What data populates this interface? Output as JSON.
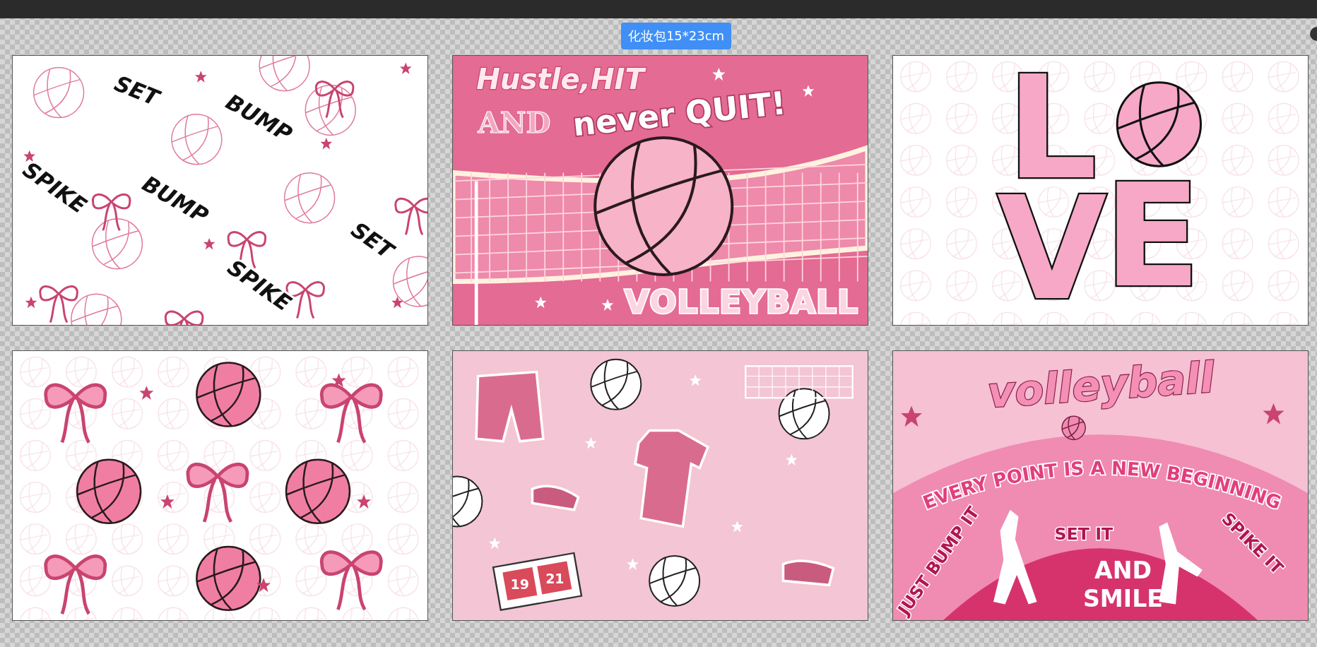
{
  "badge": "化妆包15*23cm",
  "designs": [
    {
      "kind": "pattern",
      "words": [
        "SET",
        "BUMP",
        "SPIKE",
        "BUMP",
        "SET",
        "SPIKE"
      ]
    },
    {
      "kind": "net",
      "lines": [
        "Hustle,HIT",
        "AND",
        "never QUIT!"
      ],
      "footer": "VOLLEYBALL"
    },
    {
      "kind": "love",
      "letters": [
        "L",
        "V",
        "E"
      ]
    },
    {
      "kind": "bows"
    },
    {
      "kind": "gear",
      "calendar": [
        "19",
        "21"
      ]
    },
    {
      "kind": "silhouettes",
      "title": "volleyball",
      "arc": "EVERY POINT IS A NEW BEGINNING",
      "left": "JUST BUMP IT",
      "center": "SET IT",
      "right": "SPIKE IT",
      "bottom": [
        "AND",
        "SMILE"
      ]
    }
  ]
}
